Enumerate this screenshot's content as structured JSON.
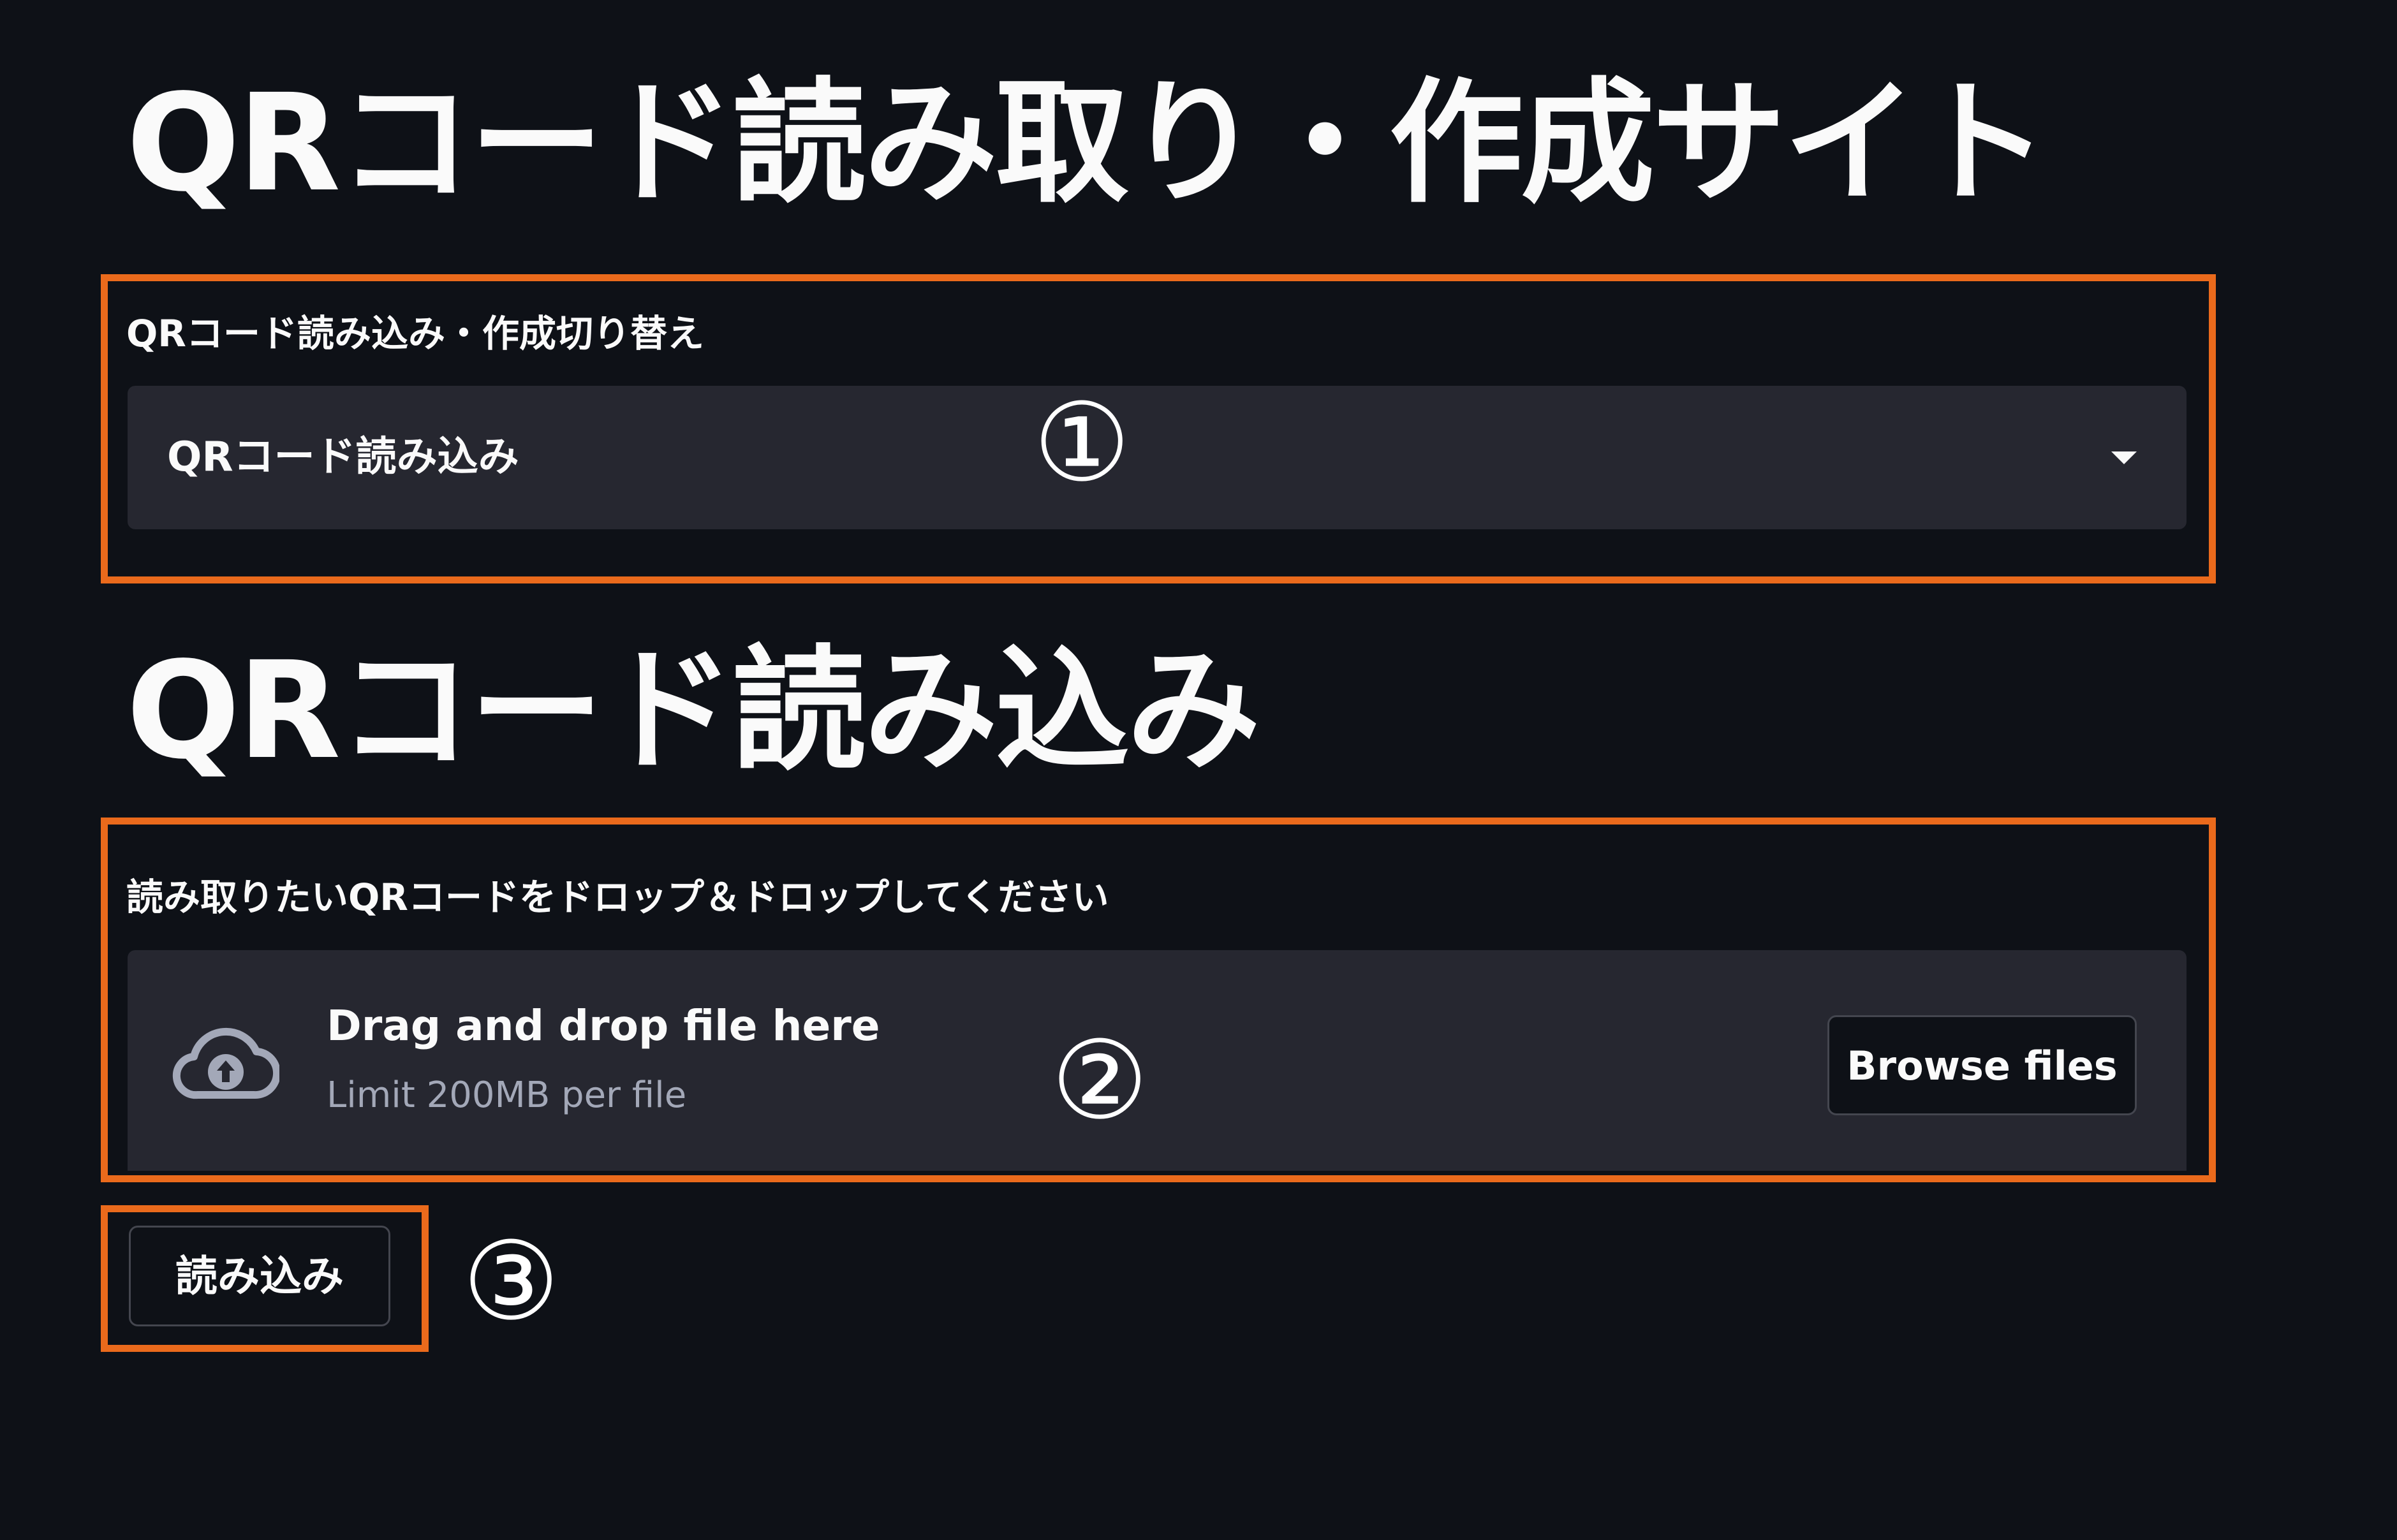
{
  "header": {
    "title": "QRコード読み取り・作成サイト"
  },
  "mode_select": {
    "label": "QRコード読み込み・作成切り替え",
    "value": "QRコード読み込み"
  },
  "section": {
    "title": "QRコード読み込み"
  },
  "uploader": {
    "label": "読み取りたいQRコードをドロップ＆ドロップしてください",
    "drop_text": "Drag and drop file here",
    "limit_text": "Limit 200MB per file",
    "browse_label": "Browse files",
    "icon": "cloud-upload-icon"
  },
  "read_button": {
    "label": "読み込み"
  },
  "annotations": {
    "marker_1": "①",
    "marker_2": "②",
    "marker_3": "③",
    "highlight_color": "#ea6a1c"
  },
  "theme": {
    "background": "#0e1117",
    "widget_background": "#262730",
    "text": "#fafafa",
    "muted_text": "#a3a8b8"
  }
}
